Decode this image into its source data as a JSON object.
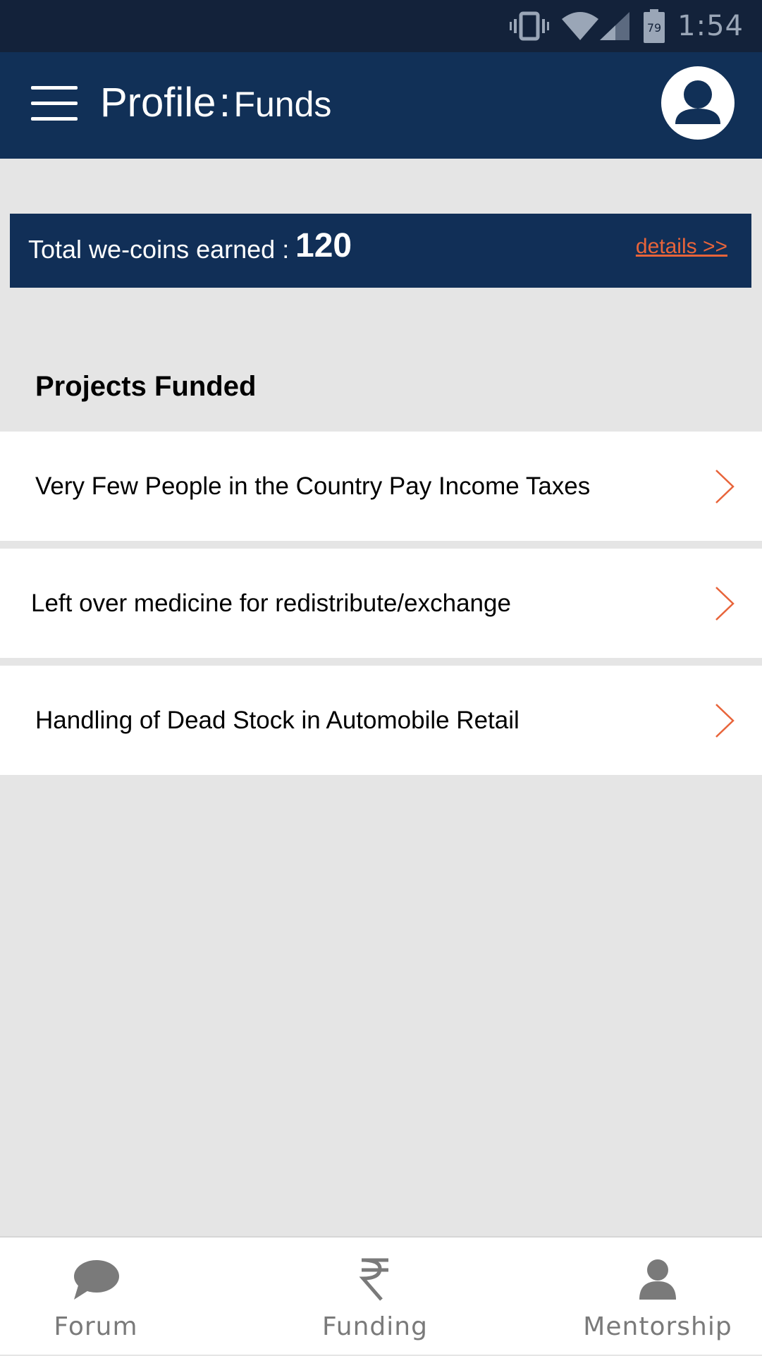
{
  "status_bar": {
    "time": "1:54",
    "battery_level": "79",
    "icons": [
      "vibrate-icon",
      "wifi-icon",
      "signal-icon",
      "battery-icon"
    ]
  },
  "app_bar": {
    "title_main": "Profile",
    "title_separator": ":",
    "title_sub": "Funds",
    "menu_icon": "hamburger-menu-icon",
    "avatar_icon": "user-avatar-icon"
  },
  "coins": {
    "label": "Total we-coins earned :",
    "value": "120",
    "details_link": "details >>"
  },
  "projects": {
    "section_title": "Projects Funded",
    "items": [
      {
        "title": "Very Few People in the Country Pay Income Taxes"
      },
      {
        "title": "Left over medicine for redistribute/exchange"
      },
      {
        "title": "Handling of Dead Stock in Automobile Retail"
      }
    ]
  },
  "bottom_nav": {
    "items": [
      {
        "label": "Forum",
        "icon": "chat-bubble-icon"
      },
      {
        "label": "Funding",
        "icon": "rupee-icon"
      },
      {
        "label": "Mentorship",
        "icon": "person-icon"
      }
    ]
  },
  "colors": {
    "primary": "#113057",
    "status_bar": "#13223a",
    "accent": "#e8643a",
    "background": "#e5e5e5"
  }
}
